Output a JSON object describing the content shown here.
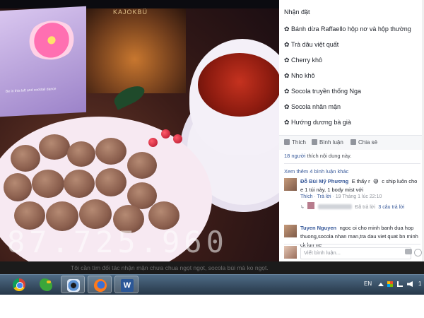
{
  "photo": {
    "phone_watermark": "87.725.960",
    "lamp_label": "KAJOKBÜ",
    "card_text": "Be in this loft and cocktail dance"
  },
  "post": {
    "title": "Nhận đặt",
    "items": [
      "Bánh dừa Raffaello hộp nơ và hộp thường",
      "Trà dâu việt quất",
      "Cherry khô",
      "Nho khô",
      "Socola truyền thống Nga",
      "Socola nhân mận",
      "Hướng dương bà già"
    ],
    "bullet": "✿",
    "actions": {
      "like": "Thích",
      "comment": "Bình luận",
      "share": "Chia sẻ"
    },
    "likes": {
      "count": "18 người",
      "rest": "thích nội dung này."
    },
    "more_comments": "Xem thêm 4 bình luận khác",
    "comments": [
      {
        "name": "Đỗ Bùi Mỹ Phương",
        "text_a": "E thấy r",
        "emoji": "😅",
        "text_b": "c ship luôn cho e 1 túi này, 1 body mist với",
        "like": "Thích",
        "reply": "Trả lời",
        "time": "19 Tháng 1 lúc 22:10",
        "reply_name_suffix": "Đã trả lời",
        "reply_count": "3 câu trả lời"
      },
      {
        "name": "Tuyen Nguyen",
        "text": "ngoc oi cho minh banh dua hop thuong,socola nhan man,tra dau viet quat bn minh ck lun ne"
      }
    ],
    "write_placeholder": "Viết bình luận..."
  },
  "caption": "Tôi cần tìm đối tác nhận mận chưa chua ngọt ngọt, socola bùi mà ko ngọt.",
  "taskbar": {
    "apps": [
      "chrome-icon",
      "bird-icon",
      "camera-icon",
      "firefox-icon",
      "word-icon"
    ],
    "word_letter": "W",
    "lang": "EN",
    "clock": "1"
  }
}
